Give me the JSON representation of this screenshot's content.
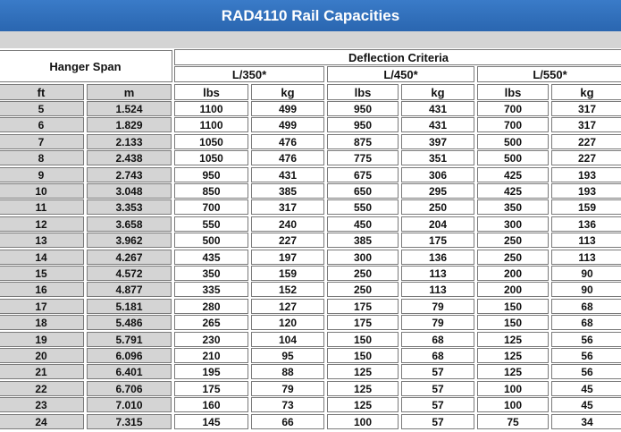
{
  "title": "RAD4110 Rail Capacities",
  "headers": {
    "hanger_span": "Hanger Span",
    "deflection": "Deflection Criteria",
    "criteria": [
      "L/350*",
      "L/450*",
      "L/550*"
    ],
    "units": [
      "ft",
      "m",
      "lbs",
      "kg",
      "lbs",
      "kg",
      "lbs",
      "kg"
    ]
  },
  "rows": [
    [
      "5",
      "1.524",
      "1100",
      "499",
      "950",
      "431",
      "700",
      "317"
    ],
    [
      "6",
      "1.829",
      "1100",
      "499",
      "950",
      "431",
      "700",
      "317"
    ],
    [
      "7",
      "2.133",
      "1050",
      "476",
      "875",
      "397",
      "500",
      "227"
    ],
    [
      "8",
      "2.438",
      "1050",
      "476",
      "775",
      "351",
      "500",
      "227"
    ],
    [
      "9",
      "2.743",
      "950",
      "431",
      "675",
      "306",
      "425",
      "193"
    ],
    [
      "10",
      "3.048",
      "850",
      "385",
      "650",
      "295",
      "425",
      "193"
    ],
    [
      "11",
      "3.353",
      "700",
      "317",
      "550",
      "250",
      "350",
      "159"
    ],
    [
      "12",
      "3.658",
      "550",
      "240",
      "450",
      "204",
      "300",
      "136"
    ],
    [
      "13",
      "3.962",
      "500",
      "227",
      "385",
      "175",
      "250",
      "113"
    ],
    [
      "14",
      "4.267",
      "435",
      "197",
      "300",
      "136",
      "250",
      "113"
    ],
    [
      "15",
      "4.572",
      "350",
      "159",
      "250",
      "113",
      "200",
      "90"
    ],
    [
      "16",
      "4.877",
      "335",
      "152",
      "250",
      "113",
      "200",
      "90"
    ],
    [
      "17",
      "5.181",
      "280",
      "127",
      "175",
      "79",
      "150",
      "68"
    ],
    [
      "18",
      "5.486",
      "265",
      "120",
      "175",
      "79",
      "150",
      "68"
    ],
    [
      "19",
      "5.791",
      "230",
      "104",
      "150",
      "68",
      "125",
      "56"
    ],
    [
      "20",
      "6.096",
      "210",
      "95",
      "150",
      "68",
      "125",
      "56"
    ],
    [
      "21",
      "6.401",
      "195",
      "88",
      "125",
      "57",
      "125",
      "56"
    ],
    [
      "22",
      "6.706",
      "175",
      "79",
      "125",
      "57",
      "100",
      "45"
    ],
    [
      "23",
      "7.010",
      "160",
      "73",
      "125",
      "57",
      "100",
      "45"
    ],
    [
      "24",
      "7.315",
      "145",
      "66",
      "100",
      "57",
      "75",
      "34"
    ]
  ]
}
